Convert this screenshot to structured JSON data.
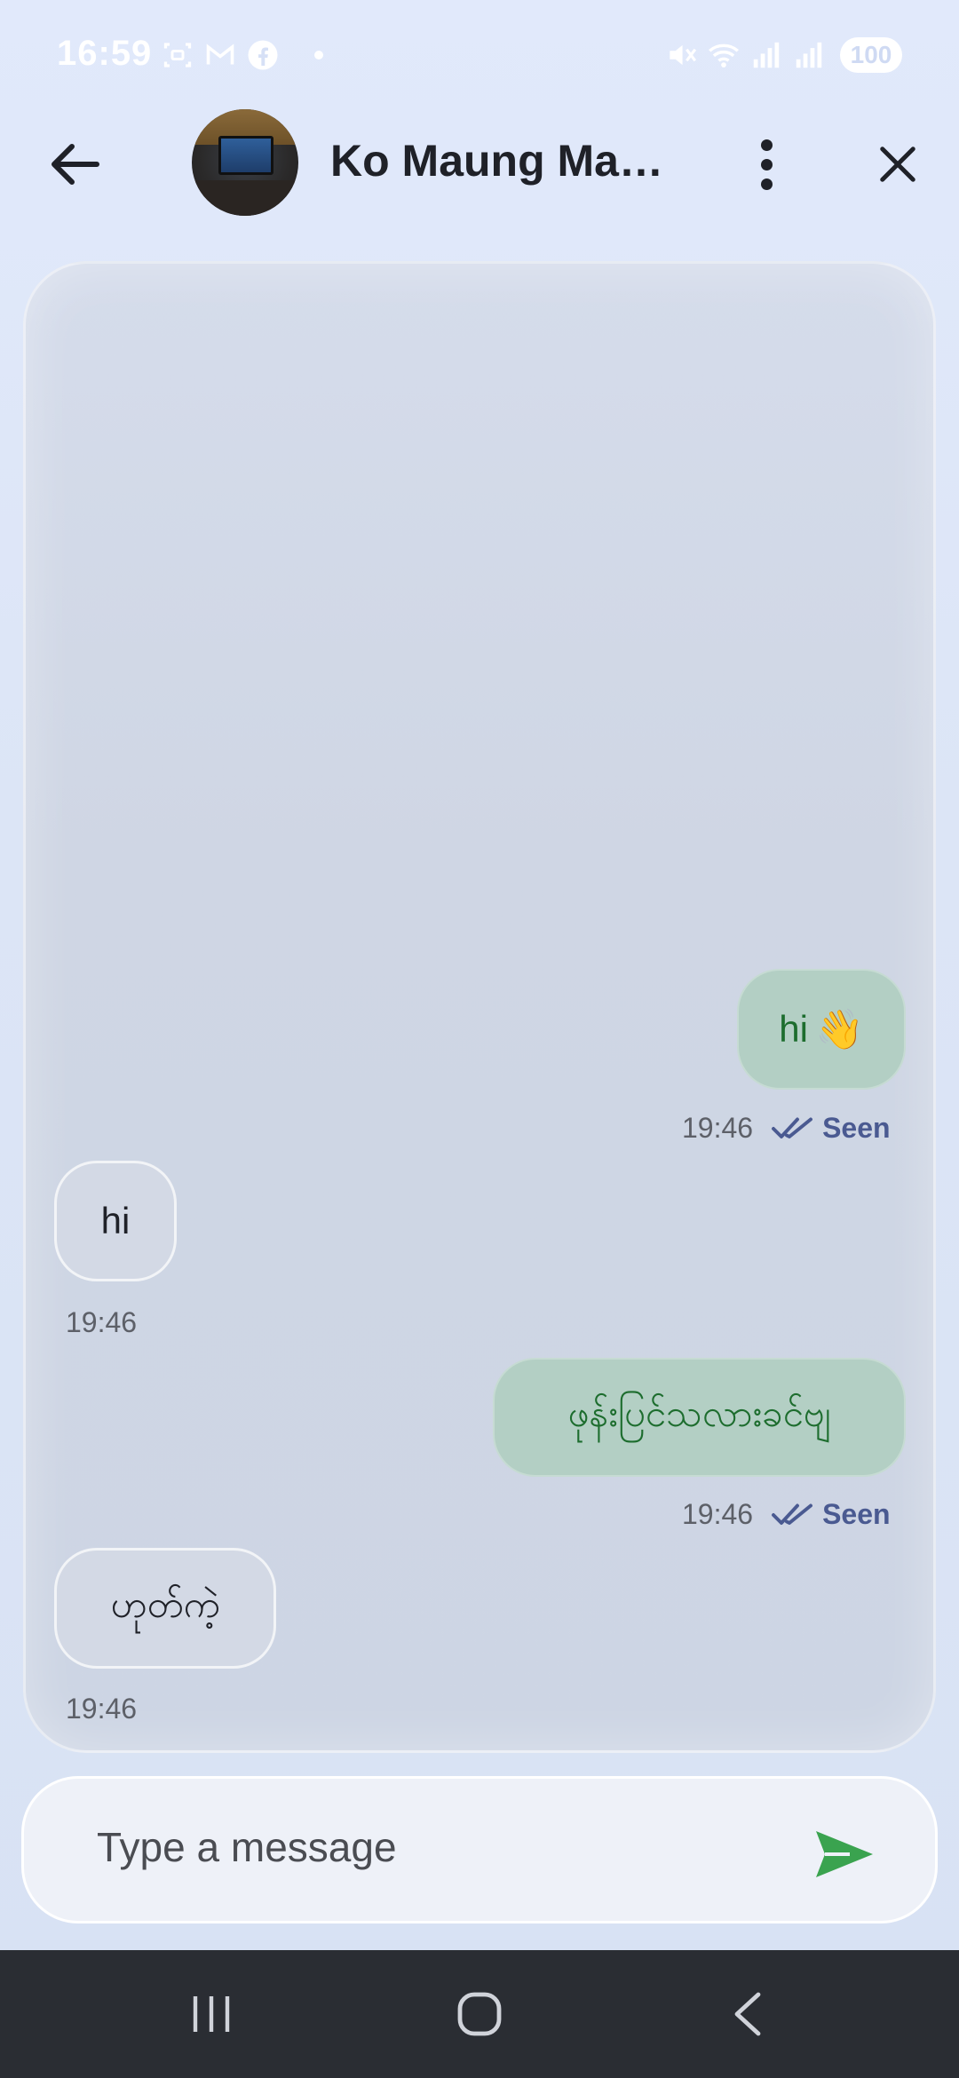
{
  "status_bar": {
    "time": "16:59",
    "left_icons": [
      "screenshot-icon",
      "gmail-icon",
      "facebook-icon",
      "dot-icon"
    ],
    "right_icons": [
      "mute-icon",
      "wifi-icon",
      "signal-icon",
      "signal-icon"
    ],
    "battery": "100"
  },
  "header": {
    "contact_name": "Ko Maung Maung Htay",
    "avatar": "avatar-photo"
  },
  "messages": [
    {
      "direction": "sent",
      "text": "hi",
      "emoji": "👋",
      "time": "19:46",
      "status": "Seen"
    },
    {
      "direction": "received",
      "text": "hi",
      "time": "19:46"
    },
    {
      "direction": "sent",
      "text": "ဖုန်းပြင်သလားခင်ဗျ",
      "time": "19:46",
      "status": "Seen"
    },
    {
      "direction": "received",
      "text": "ဟုတ်ကဲ့",
      "time": "19:46"
    }
  ],
  "composer": {
    "placeholder": "Type a message"
  },
  "colors": {
    "sent_text": "#1d6d2e",
    "seen": "#4a5a91",
    "send_icon": "#3aa34f"
  }
}
